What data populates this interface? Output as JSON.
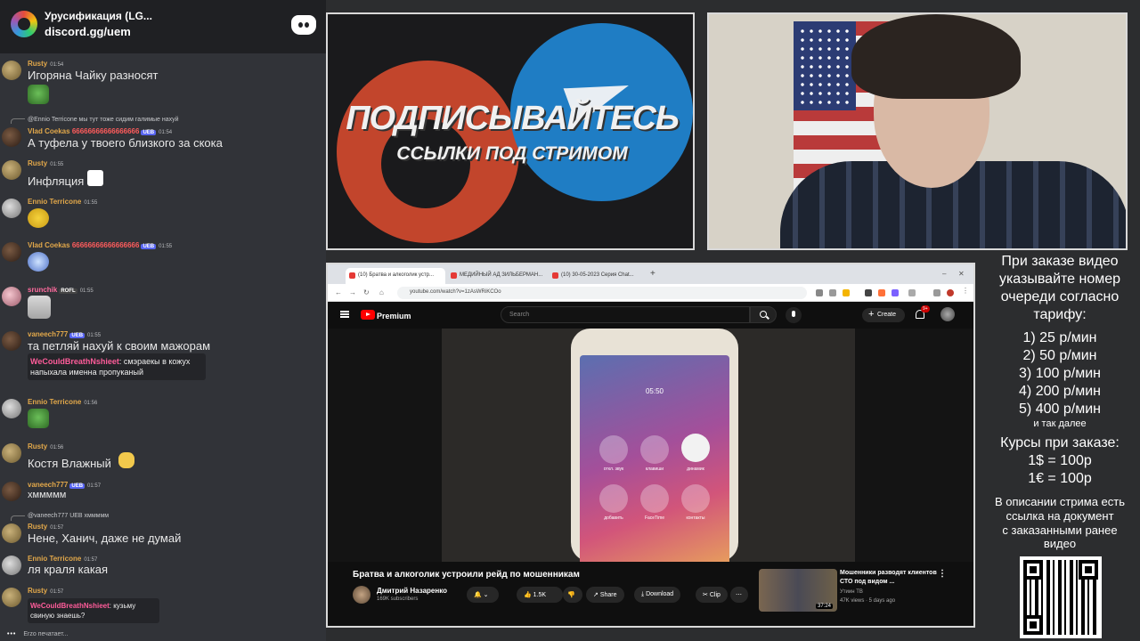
{
  "server": {
    "name": "Урусификация (LG...",
    "link": "discord.gg/uem"
  },
  "chat": {
    "messages": [
      {
        "user": "Rusty",
        "time": "01:54",
        "text": "Игоряна Чайку разносят"
      },
      {
        "reply": "@Ennio Terricone мы тут тоже сидим галимые нахуй",
        "user": "Vlad Coekas",
        "user_suffix": "66666666666666666",
        "badge": "UEB",
        "time": "01:54",
        "text": "А туфела у твоего близкого за скока"
      },
      {
        "user": "Rusty",
        "time": "01:55",
        "text": "Инфляция"
      },
      {
        "user": "Ennio Terricone",
        "time": "01:55"
      },
      {
        "user": "Vlad Coekas",
        "user_suffix": "66666666666666666",
        "badge": "UEB",
        "time": "01:55"
      },
      {
        "user": "srunchik",
        "badge": "ROFL",
        "time": "01:55"
      },
      {
        "user": "vaneech777",
        "badge": "UEB",
        "time": "01:55",
        "text": "та петляй нахуй к своим мажорам",
        "highlight_user": "WeCouldBreathNshieet",
        "highlight_text": ": смэраекы в кожух напыхала именна пропуканый"
      },
      {
        "user": "Ennio Terricone",
        "time": "01:56"
      },
      {
        "user": "Rusty",
        "time": "01:56",
        "text": "Костя Влажный"
      },
      {
        "user": "vaneech777",
        "badge": "UEB",
        "time": "01:57",
        "text": "хммммм"
      },
      {
        "reply": "@vaneech777 UEB хммммм",
        "user": "Rusty",
        "time": "01:57",
        "text": "Нене, Ханич, даже не думай"
      },
      {
        "user": "Ennio Terricone",
        "time": "01:57",
        "text": "ля краля какая"
      },
      {
        "user": "Rusty",
        "time": "01:57",
        "highlight_user": "WeCouldBreathNshieet",
        "highlight_text": ": кузьму свиную знаешь?"
      }
    ],
    "typing": "Erzo печатает..."
  },
  "promo": {
    "title": "ПОДПИСЫВАЙТЕСЬ",
    "subtitle": "ССЫЛКИ ПОД СТРИМОМ"
  },
  "browser": {
    "tabs": [
      "(10) Братва и алкоголик устр...",
      "МЕДИЙНЫЙ АД ЗИЛЬБЕРМАН...",
      "(10) 30-05-2023 Серия Chat..."
    ],
    "url": "youtube.com/watch?v=1zAsWRiKCOo",
    "search_placeholder": "Search",
    "premium": "Premium",
    "create": "Create",
    "notifications": "9+",
    "phone": {
      "time": "05:50",
      "labels": [
        "откл. звук",
        "клавиши",
        "динамик",
        "добавить",
        "FaceTime",
        "контакты"
      ]
    },
    "video_title": "Братва и алкоголик устроили рейд по мошенникам",
    "channel": "Дмитрий Назаренко",
    "subs": "169K subscribers",
    "likes": "1.5K",
    "share": "Share",
    "download": "Download",
    "clip": "Clip",
    "related": {
      "title": "Мошенники разводят клиентов СТО под видом ...",
      "channel": "Утиин ТВ",
      "meta": "47K views · 5 days ago",
      "duration": "37:24"
    }
  },
  "info": {
    "lines": [
      "При заказе видео",
      "указывайте номер",
      "очереди согласно",
      "тарифу:"
    ],
    "prices": [
      "1) 25 р/мин",
      "2) 50 р/мин",
      "3) 100 р/мин",
      "4) 200 р/мин",
      "5) 400 р/мин"
    ],
    "etc": "и так далее",
    "rates_title": "Курсы при заказе:",
    "rates": [
      "1$ = 100р",
      "1€ = 100р"
    ],
    "desc": [
      "В описании стрима есть",
      "ссылка на документ",
      "с заказанными ранее",
      "видео"
    ]
  }
}
